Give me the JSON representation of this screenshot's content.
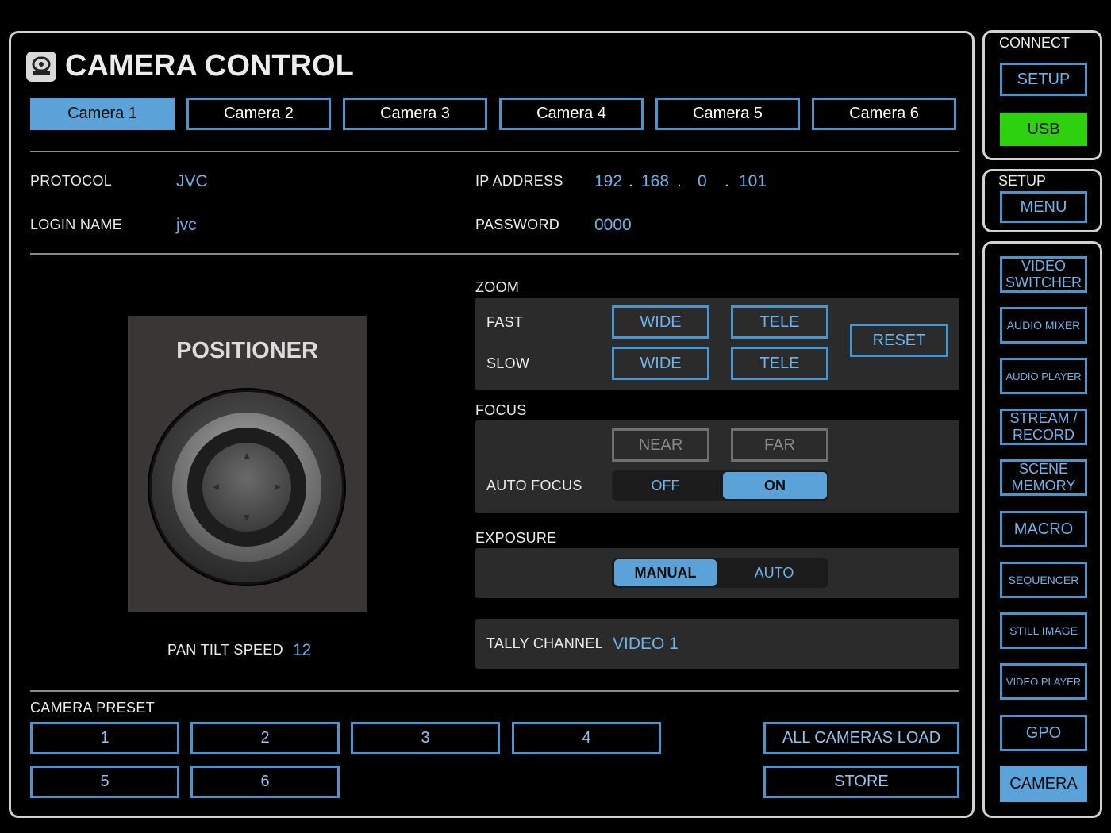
{
  "header": {
    "title": "CAMERA CONTROL"
  },
  "tabs": [
    "Camera 1",
    "Camera 2",
    "Camera 3",
    "Camera 4",
    "Camera 5",
    "Camera 6"
  ],
  "active_tab": "Camera 1",
  "connection": {
    "protocol_label": "PROTOCOL",
    "protocol_value": "JVC",
    "login_label": "LOGIN NAME",
    "login_value": "jvc",
    "ip_label": "IP ADDRESS",
    "ip": [
      "192",
      "168",
      "0",
      "101"
    ],
    "ip_dot": ".",
    "password_label": "PASSWORD",
    "password_value": "0000"
  },
  "positioner": {
    "title": "POSITIONER",
    "speed_label": "PAN TILT SPEED",
    "speed_value": "12"
  },
  "zoom": {
    "title": "ZOOM",
    "fast_label": "FAST",
    "slow_label": "SLOW",
    "wide": "WIDE",
    "tele": "TELE",
    "reset": "RESET"
  },
  "focus": {
    "title": "FOCUS",
    "near": "NEAR",
    "far": "FAR",
    "auto_label": "AUTO FOCUS",
    "off": "OFF",
    "on": "ON",
    "auto_state": "ON"
  },
  "exposure": {
    "title": "EXPOSURE",
    "manual": "MANUAL",
    "auto": "AUTO",
    "state": "MANUAL"
  },
  "tally": {
    "label": "TALLY CHANNEL",
    "value": "VIDEO 1"
  },
  "preset": {
    "title": "CAMERA PRESET",
    "buttons": [
      "1",
      "2",
      "3",
      "4",
      "5",
      "6"
    ],
    "all_load": "ALL CAMERAS LOAD",
    "store": "STORE"
  },
  "sidebar": {
    "connect_title": "CONNECT",
    "setup_button": "SETUP",
    "usb_button": "USB",
    "setup_title": "SETUP",
    "menu_button": "MENU",
    "nav": [
      "VIDEO\nSWITCHER",
      "AUDIO MIXER",
      "AUDIO PLAYER",
      "STREAM /\nRECORD",
      "SCENE\nMEMORY",
      "MACRO",
      "SEQUENCER",
      "STILL IMAGE",
      "VIDEO PLAYER",
      "GPO",
      "CAMERA"
    ],
    "active": "CAMERA"
  },
  "colors": {
    "accent": "#5aa2d8",
    "border_blue": "#4b95cf",
    "usb_green": "#2ed10f",
    "panel_gray": "#2b2b2b"
  }
}
